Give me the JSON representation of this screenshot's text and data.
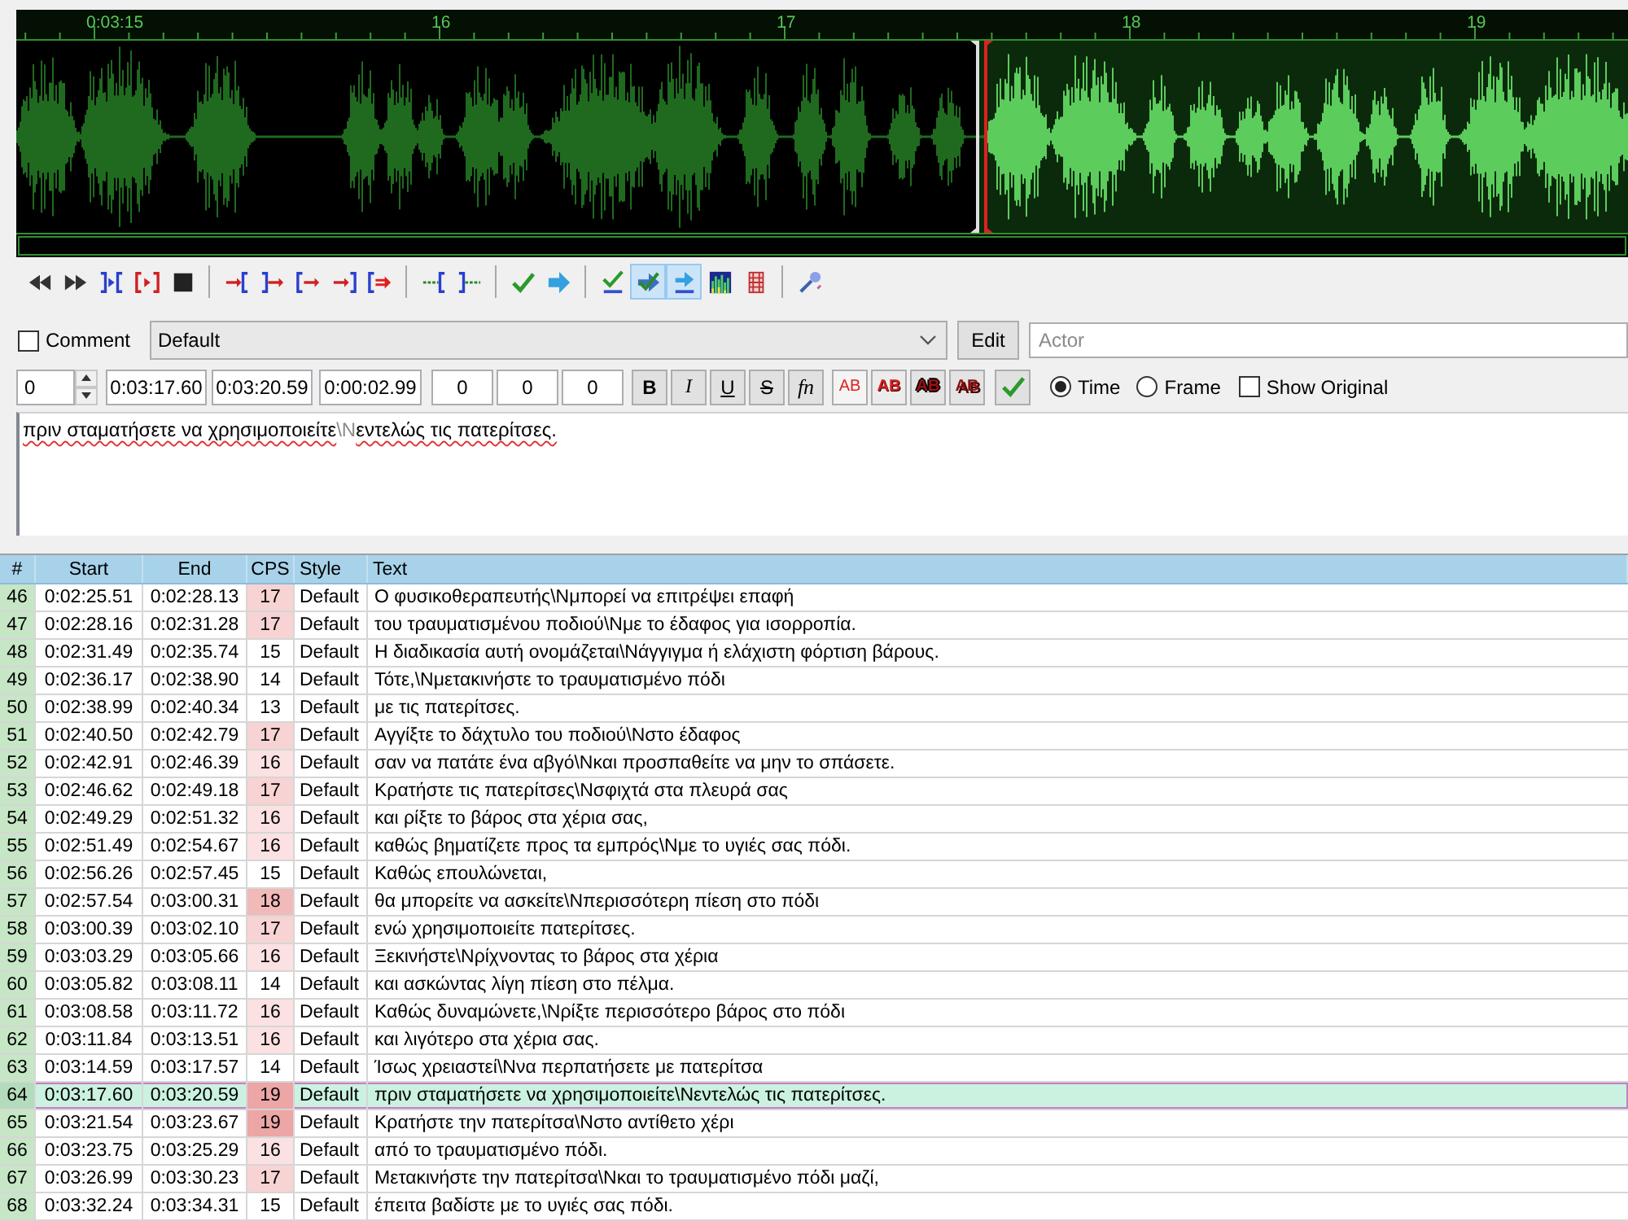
{
  "waveform": {
    "ruler_labels": [
      "0:03:15",
      "16",
      "17",
      "18",
      "19"
    ]
  },
  "toolbar": {
    "groups": [
      [
        {
          "kind": "rewind",
          "pressed": false
        },
        {
          "kind": "forward",
          "pressed": false
        },
        {
          "kind": "play-selection",
          "pressed": false
        },
        {
          "kind": "play-line",
          "pressed": false
        },
        {
          "kind": "stop",
          "pressed": false
        }
      ],
      [
        {
          "kind": "play-before",
          "pressed": false
        },
        {
          "kind": "play-after-start",
          "pressed": false
        },
        {
          "kind": "play-begin",
          "pressed": false
        },
        {
          "kind": "play-end",
          "pressed": false
        },
        {
          "kind": "play-after",
          "pressed": false
        }
      ],
      [
        {
          "kind": "lead-in",
          "pressed": false
        },
        {
          "kind": "lead-out",
          "pressed": false
        }
      ],
      [
        {
          "kind": "commit",
          "pressed": false
        },
        {
          "kind": "next",
          "pressed": false
        }
      ],
      [
        {
          "kind": "auto-commit",
          "pressed": false
        },
        {
          "kind": "auto-next-check",
          "pressed": true
        },
        {
          "kind": "auto-scroll",
          "pressed": true
        },
        {
          "kind": "spectrum",
          "pressed": false
        },
        {
          "kind": "video-sync",
          "pressed": false
        }
      ],
      [
        {
          "kind": "karaoke",
          "pressed": false
        }
      ]
    ]
  },
  "edit": {
    "comment": {
      "label": "Comment",
      "checked": false
    },
    "style": "Default",
    "edit_button": "Edit",
    "actor": {
      "placeholder": "Actor"
    },
    "layer": "0",
    "start": "0:03:17.60",
    "end": "0:03:20.59",
    "duration": "0:00:02.99",
    "margins": [
      "0",
      "0",
      "0"
    ],
    "format_buttons": [
      {
        "kind": "bold",
        "label": "B"
      },
      {
        "kind": "italic",
        "label": "I"
      },
      {
        "kind": "underline",
        "label": "U"
      },
      {
        "kind": "strike",
        "label": "S"
      },
      {
        "kind": "font",
        "label": "fn"
      }
    ],
    "color_buttons": [
      {
        "kind": "primary",
        "label": "AB"
      },
      {
        "kind": "secondary",
        "label": "AB"
      },
      {
        "kind": "outline",
        "label": "AB"
      },
      {
        "kind": "shadow",
        "label": "AB"
      }
    ],
    "time_mode": [
      {
        "label": "Time",
        "selected": true
      },
      {
        "label": "Frame",
        "selected": false
      }
    ],
    "show_original": {
      "label": "Show Original",
      "checked": false
    },
    "text": [
      {
        "kind": "text",
        "text": "πριν σταματήσετε να χρησιμοποιείτε"
      },
      {
        "kind": "tag",
        "text": "\\N"
      },
      {
        "kind": "text",
        "text": "εντελώς τις πατερίτσες."
      }
    ]
  },
  "grid": {
    "columns": [
      "#",
      "Start",
      "End",
      "CPS",
      "Style",
      "Text"
    ],
    "rows": [
      {
        "number": "46",
        "start": "0:02:25.51",
        "end": "0:02:28.13",
        "cps": {
          "text": "17",
          "color": "#f8d3d3"
        },
        "style": "Default",
        "text": "Ο φυσικοθεραπευτής\\Nμπορεί να επιτρέψει επαφή",
        "selected": false
      },
      {
        "number": "47",
        "start": "0:02:28.16",
        "end": "0:02:31.28",
        "cps": {
          "text": "17",
          "color": "#f8d3d3"
        },
        "style": "Default",
        "text": "του τραυματισμένου ποδιού\\Nμε το έδαφος για ισορροπία.",
        "selected": false
      },
      {
        "number": "48",
        "start": "0:02:31.49",
        "end": "0:02:35.74",
        "cps": {
          "text": "15",
          "color": "#ffffff"
        },
        "style": "Default",
        "text": "Η διαδικασία αυτή ονομάζεται\\Nάγγιγμα ή ελάχιστη φόρτιση βάρους.",
        "selected": false
      },
      {
        "number": "49",
        "start": "0:02:36.17",
        "end": "0:02:38.90",
        "cps": {
          "text": "14",
          "color": "#ffffff"
        },
        "style": "Default",
        "text": "Τότε,\\Nμετακινήστε το τραυματισμένο πόδι",
        "selected": false
      },
      {
        "number": "50",
        "start": "0:02:38.99",
        "end": "0:02:40.34",
        "cps": {
          "text": "13",
          "color": "#ffffff"
        },
        "style": "Default",
        "text": "με τις πατερίτσες.",
        "selected": false
      },
      {
        "number": "51",
        "start": "0:02:40.50",
        "end": "0:02:42.79",
        "cps": {
          "text": "17",
          "color": "#f8d3d3"
        },
        "style": "Default",
        "text": "Αγγίξτε το δάχτυλο του ποδιού\\Nστο έδαφος",
        "selected": false
      },
      {
        "number": "52",
        "start": "0:02:42.91",
        "end": "0:02:46.39",
        "cps": {
          "text": "16",
          "color": "#fbe1e1"
        },
        "style": "Default",
        "text": "σαν να πατάτε ένα αβγό\\Nκαι προσπαθείτε να μην το σπάσετε.",
        "selected": false
      },
      {
        "number": "53",
        "start": "0:02:46.62",
        "end": "0:02:49.18",
        "cps": {
          "text": "17",
          "color": "#f8d3d3"
        },
        "style": "Default",
        "text": "Κρατήστε τις πατερίτσες\\Nσφιχτά στα πλευρά σας",
        "selected": false
      },
      {
        "number": "54",
        "start": "0:02:49.29",
        "end": "0:02:51.32",
        "cps": {
          "text": "16",
          "color": "#fbe1e1"
        },
        "style": "Default",
        "text": "και ρίξτε το βάρος στα χέρια σας,",
        "selected": false
      },
      {
        "number": "55",
        "start": "0:02:51.49",
        "end": "0:02:54.67",
        "cps": {
          "text": "16",
          "color": "#fbe1e1"
        },
        "style": "Default",
        "text": "καθώς βηματίζετε προς τα εμπρός\\Nμε το υγιές σας πόδι.",
        "selected": false
      },
      {
        "number": "56",
        "start": "0:02:56.26",
        "end": "0:02:57.45",
        "cps": {
          "text": "15",
          "color": "#ffffff"
        },
        "style": "Default",
        "text": "Καθώς επουλώνεται,",
        "selected": false
      },
      {
        "number": "57",
        "start": "0:02:57.54",
        "end": "0:03:00.31",
        "cps": {
          "text": "18",
          "color": "#f2b9b9"
        },
        "style": "Default",
        "text": "θα μπορείτε να ασκείτε\\Nπερισσότερη πίεση στο πόδι",
        "selected": false
      },
      {
        "number": "58",
        "start": "0:03:00.39",
        "end": "0:03:02.10",
        "cps": {
          "text": "17",
          "color": "#f8d3d3"
        },
        "style": "Default",
        "text": "ενώ χρησιμοποιείτε πατερίτσες.",
        "selected": false
      },
      {
        "number": "59",
        "start": "0:03:03.29",
        "end": "0:03:05.66",
        "cps": {
          "text": "16",
          "color": "#fbe1e1"
        },
        "style": "Default",
        "text": "Ξεκινήστε\\Nρίχνοντας το βάρος στα χέρια",
        "selected": false
      },
      {
        "number": "60",
        "start": "0:03:05.82",
        "end": "0:03:08.11",
        "cps": {
          "text": "14",
          "color": "#ffffff"
        },
        "style": "Default",
        "text": "και ασκώντας λίγη πίεση στο πέλμα.",
        "selected": false
      },
      {
        "number": "61",
        "start": "0:03:08.58",
        "end": "0:03:11.72",
        "cps": {
          "text": "16",
          "color": "#fbe1e1"
        },
        "style": "Default",
        "text": "Καθώς δυναμώνετε,\\Nρίξτε περισσότερο βάρος στο πόδι",
        "selected": false
      },
      {
        "number": "62",
        "start": "0:03:11.84",
        "end": "0:03:13.51",
        "cps": {
          "text": "16",
          "color": "#fbe1e1"
        },
        "style": "Default",
        "text": "και λιγότερο στα χέρια σας.",
        "selected": false
      },
      {
        "number": "63",
        "start": "0:03:14.59",
        "end": "0:03:17.57",
        "cps": {
          "text": "14",
          "color": "#ffffff"
        },
        "style": "Default",
        "text": "Ίσως χρειαστεί\\Nνα περπατήσετε με πατερίτσα",
        "selected": false
      },
      {
        "number": "64",
        "start": "0:03:17.60",
        "end": "0:03:20.59",
        "cps": {
          "text": "19",
          "color": "#eca6a6"
        },
        "style": "Default",
        "text": "πριν σταματήσετε να χρησιμοποιείτε\\Nεντελώς τις πατερίτσες.",
        "selected": true
      },
      {
        "number": "65",
        "start": "0:03:21.54",
        "end": "0:03:23.67",
        "cps": {
          "text": "19",
          "color": "#eca6a6"
        },
        "style": "Default",
        "text": "Κρατήστε την πατερίτσα\\Nστο αντίθετο χέρι",
        "selected": false
      },
      {
        "number": "66",
        "start": "0:03:23.75",
        "end": "0:03:25.29",
        "cps": {
          "text": "16",
          "color": "#fbe1e1"
        },
        "style": "Default",
        "text": "από το τραυματισμένο πόδι.",
        "selected": false
      },
      {
        "number": "67",
        "start": "0:03:26.99",
        "end": "0:03:30.23",
        "cps": {
          "text": "17",
          "color": "#f8d3d3"
        },
        "style": "Default",
        "text": "Μετακινήστε την πατερίτσα\\Nκαι το τραυματισμένο πόδι μαζί,",
        "selected": false
      },
      {
        "number": "68",
        "start": "0:03:32.24",
        "end": "0:03:34.31",
        "cps": {
          "text": "15",
          "color": "#ffffff"
        },
        "style": "Default",
        "text": "έπειτα βαδίστε με το υγιές σας πόδι.",
        "selected": false
      }
    ]
  }
}
